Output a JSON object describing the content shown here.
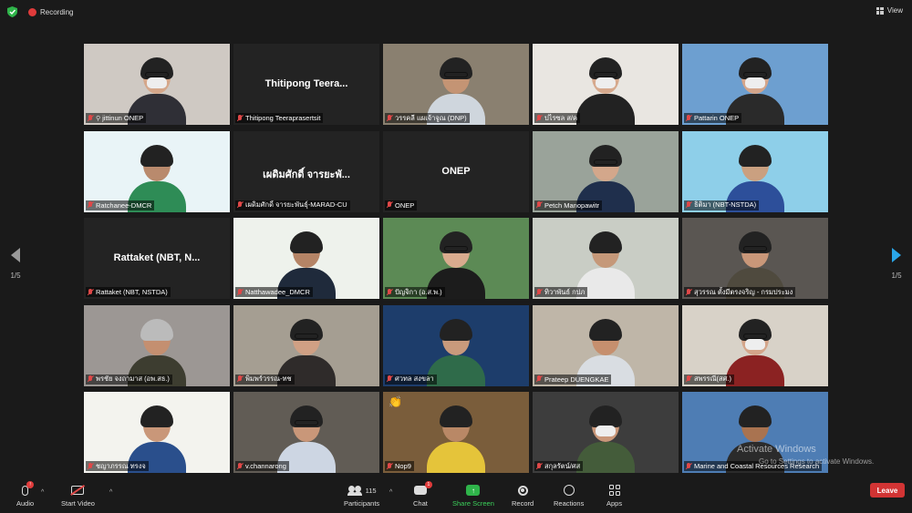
{
  "topbar": {
    "recording_label": "Recording",
    "view_label": "View"
  },
  "pager": {
    "left": "1/5",
    "right": "1/5"
  },
  "tiles": [
    {
      "name": "jittinun ONEP",
      "pinned": true,
      "video": true,
      "bg": "#cfc9c3",
      "skin": "#d5a78a",
      "shirt": "#2f2f36",
      "mask": true,
      "glasses": true
    },
    {
      "name": "Thitipong Teeraprasertsit",
      "center": "Thitipong  Teera...",
      "video": false
    },
    {
      "name": "วรรคลี แผเจ้าจูณ (DNP)",
      "video": true,
      "bg": "#8a8070",
      "skin": "#c49474",
      "shirt": "#cfd6dd",
      "glasses": true
    },
    {
      "name": "ปไรซล ส/ค",
      "video": true,
      "bg": "#e9e6e1",
      "skin": "#d6a98d",
      "shirt": "#222",
      "mask": true,
      "glasses": true,
      "speaking": true
    },
    {
      "name": "Pattarin ONEP",
      "video": true,
      "bg": "#6d9fd0",
      "skin": "#d4a58a",
      "shirt": "#2a2a2a",
      "mask": true,
      "glasses": true
    },
    {
      "name": "Ratchanee-DMCR",
      "video": true,
      "bg": "#e9f4f7",
      "skin": "#b98a6d",
      "shirt": "#2e8c56"
    },
    {
      "name": "เผดิมศักดิ์ จารยะพันธุ์-MARAD-CU",
      "center": "เผดิมศักดิ์ จารยะพั...",
      "video": false
    },
    {
      "name": "ONEP",
      "center": "ONEP",
      "video": false
    },
    {
      "name": "Petch Manopawitr",
      "video": true,
      "bg": "#9aa39a",
      "skin": "#d3a78b",
      "shirt": "#1f2f4c",
      "glasses": true
    },
    {
      "name": "ธิติมา (NBT-NSTDA)",
      "video": true,
      "bg": "#8ecfe9",
      "skin": "#caa080",
      "shirt": "#2d4f9a"
    },
    {
      "name": "Rattaket (NBT, NSTDA)",
      "center": "Rattaket (NBT, N...",
      "video": false
    },
    {
      "name": "Natthawadee_DMCR",
      "video": true,
      "bg": "#eef2ec",
      "skin": "#b58466",
      "shirt": "#1f2a3b"
    },
    {
      "name": "ปัญจิกา (อ.ส.พ.)",
      "video": true,
      "bg": "#5c8a55",
      "skin": "#d9ab8e",
      "shirt": "#1c1c1c",
      "glasses": true
    },
    {
      "name": "ทิวาพันธ์ กปภ",
      "video": true,
      "bg": "#c9cdc5",
      "skin": "#c59879",
      "shirt": "#e9e9e9"
    },
    {
      "name": "สุวรรณ ตั้งมีตรงจริญ - กรมประมง",
      "video": true,
      "bg": "#5a5652",
      "skin": "#c99779",
      "shirt": "#4f4a3e",
      "glasses": true
    },
    {
      "name": "พรชัย จงถามาส (อพ.สธ.)",
      "video": true,
      "bg": "#9c9794",
      "skin": "#c48f70",
      "shirt": "#3d3d30",
      "hairColor": "#bbb"
    },
    {
      "name": "พิมพร์วรรณ-ทช",
      "video": true,
      "bg": "#a59e92",
      "skin": "#d0a084",
      "shirt": "#2f2b2a",
      "glasses": true
    },
    {
      "name": "ศวทล สงขลา",
      "video": true,
      "bg": "#1d3d6b",
      "skin": "#c99a7c",
      "shirt": "#2f6b4a"
    },
    {
      "name": "Prateep DUENGKAE",
      "video": true,
      "bg": "#bfb6a8",
      "skin": "#c68f6e",
      "shirt": "#d9dde2"
    },
    {
      "name": "สพรรณี(สศ.)",
      "video": true,
      "bg": "#d8d2c8",
      "skin": "#d4a58a",
      "shirt": "#8b2222",
      "mask": true,
      "glasses": true
    },
    {
      "name": "ชญาภรรณ ทรงจ",
      "video": true,
      "bg": "#f3f3ee",
      "skin": "#c99779",
      "shirt": "#2a4f8c"
    },
    {
      "name": "v.channarong",
      "video": true,
      "bg": "#615c55",
      "skin": "#c99779",
      "shirt": "#cdd6e3",
      "glasses": true
    },
    {
      "name": "Nop9",
      "video": true,
      "bg": "#7a5d3b",
      "skin": "#b98866",
      "shirt": "#e5c43a",
      "emoji": "👏"
    },
    {
      "name": "สกุลรัตน์/ศส",
      "video": true,
      "bg": "#3d3d3d",
      "skin": "#c99779",
      "shirt": "#445c3a",
      "mask": true
    },
    {
      "name": "Marine and Coastal Resources Research",
      "video": true,
      "bg": "#4e7db4",
      "skin": "#a97350",
      "shirt": "#2b2b2b"
    }
  ],
  "watermark": {
    "line1": "Activate Windows",
    "line2": "Go to Settings to activate Windows."
  },
  "toolbar": {
    "audio": "Audio",
    "audio_badge": "!",
    "start_video": "Start Video",
    "participants": "Participants",
    "participants_count": "115",
    "chat": "Chat",
    "chat_badge": "1",
    "share_screen": "Share Screen",
    "record": "Record",
    "reactions": "Reactions",
    "apps": "Apps",
    "leave": "Leave"
  },
  "colors": {
    "accent_share": "#3bd15a",
    "leave": "#d23434",
    "speaking": "#c8e84a",
    "muted": "#e04848"
  }
}
